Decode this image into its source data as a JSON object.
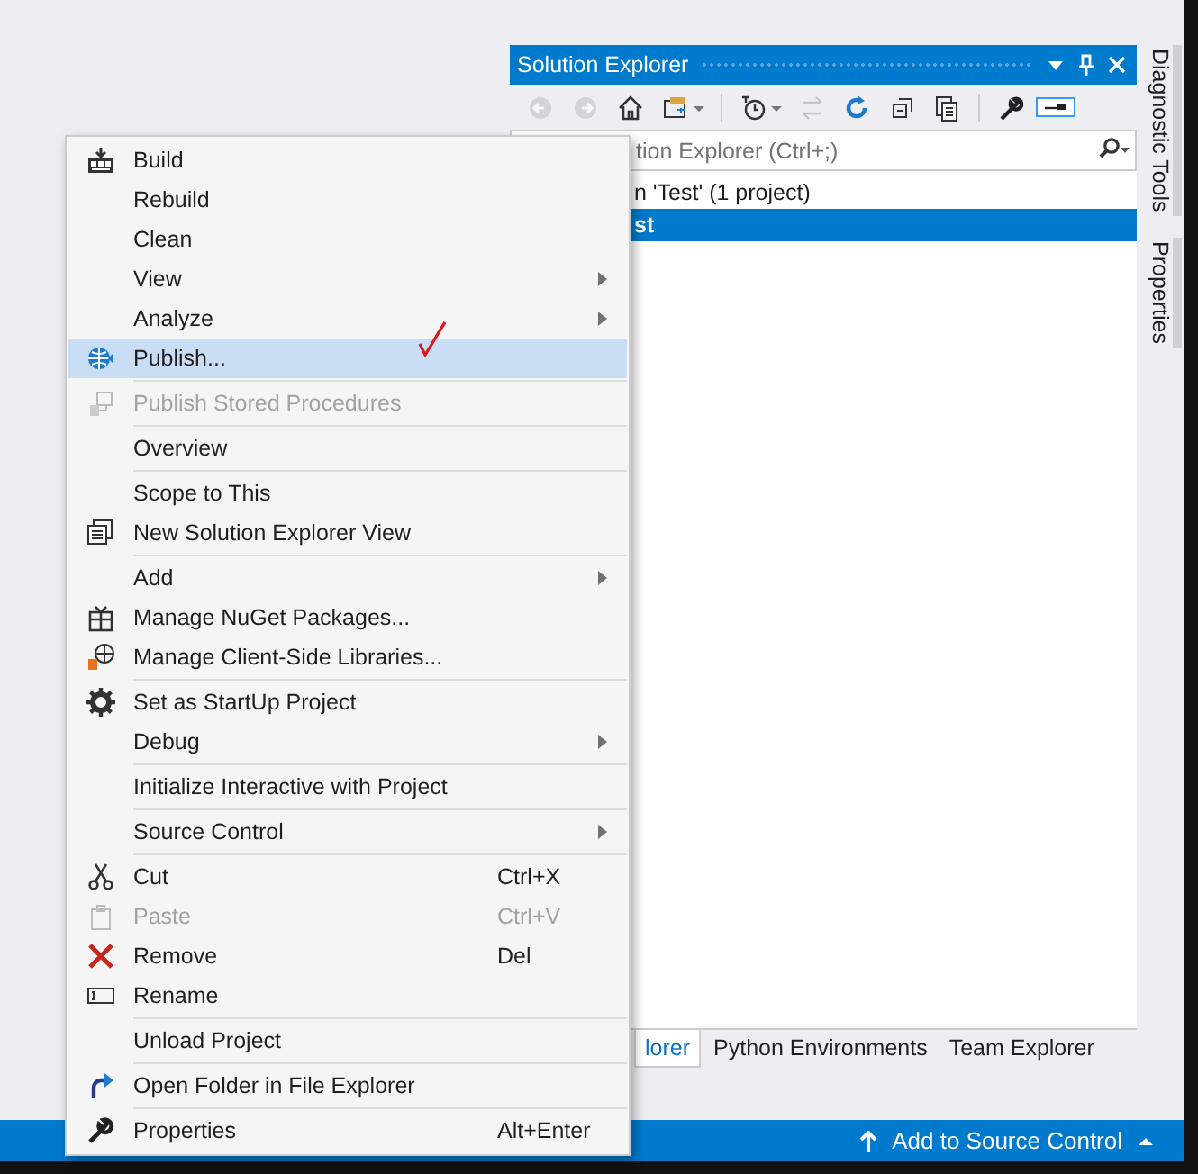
{
  "panel": {
    "title": "Solution Explorer",
    "toolbar": [
      {
        "disabled": true,
        "selected": false
      },
      {
        "disabled": true,
        "selected": false
      },
      {
        "disabled": false,
        "selected": false
      },
      {
        "disabled": false,
        "selected": false
      },
      {
        "disabled": false,
        "selected": false
      },
      {
        "disabled": true,
        "selected": false
      },
      {
        "disabled": false,
        "selected": false
      },
      {
        "disabled": false,
        "selected": false
      },
      {
        "disabled": false,
        "selected": false
      },
      {
        "disabled": false,
        "selected": false
      },
      {
        "disabled": false,
        "selected": true
      }
    ],
    "search": {
      "placeholder": "tion Explorer (Ctrl+;)"
    },
    "tree_rows": [
      {
        "label": "n 'Test' (1 project)",
        "selected": false
      },
      {
        "label": "st",
        "selected": true
      }
    ],
    "tabs": [
      {
        "label": "lorer",
        "selected": true
      },
      {
        "label": "Python Environments",
        "selected": false
      },
      {
        "label": "Team Explorer",
        "selected": false
      }
    ]
  },
  "side_tabs": [
    {
      "label": "Diagnostic Tools"
    },
    {
      "label": "Properties"
    }
  ],
  "menu": {
    "groups": [
      {
        "items": [
          {
            "label": "Build",
            "submenu": false,
            "disabled": false,
            "selected": false
          },
          {
            "label": "Rebuild",
            "submenu": false,
            "disabled": false,
            "selected": false
          },
          {
            "label": "Clean",
            "submenu": false,
            "disabled": false,
            "selected": false
          },
          {
            "label": "View",
            "submenu": true,
            "disabled": false,
            "selected": false
          },
          {
            "label": "Analyze",
            "submenu": true,
            "disabled": false,
            "selected": false
          },
          {
            "label": "Publish...",
            "submenu": false,
            "disabled": false,
            "selected": true
          }
        ]
      },
      {
        "items": [
          {
            "label": "Publish Stored Procedures",
            "submenu": false,
            "disabled": true,
            "selected": false
          }
        ]
      },
      {
        "items": [
          {
            "label": "Overview",
            "submenu": false,
            "disabled": false,
            "selected": false
          }
        ]
      },
      {
        "items": [
          {
            "label": "Scope to This",
            "submenu": false,
            "disabled": false,
            "selected": false
          },
          {
            "label": "New Solution Explorer View",
            "submenu": false,
            "disabled": false,
            "selected": false
          }
        ]
      },
      {
        "items": [
          {
            "label": "Add",
            "submenu": true,
            "disabled": false,
            "selected": false
          },
          {
            "label": "Manage NuGet Packages...",
            "submenu": false,
            "disabled": false,
            "selected": false
          },
          {
            "label": "Manage Client-Side Libraries...",
            "submenu": false,
            "disabled": false,
            "selected": false
          }
        ]
      },
      {
        "items": [
          {
            "label": "Set as StartUp Project",
            "submenu": false,
            "disabled": false,
            "selected": false
          },
          {
            "label": "Debug",
            "submenu": true,
            "disabled": false,
            "selected": false
          }
        ]
      },
      {
        "items": [
          {
            "label": "Initialize Interactive with Project",
            "submenu": false,
            "disabled": false,
            "selected": false
          }
        ]
      },
      {
        "items": [
          {
            "label": "Source Control",
            "submenu": true,
            "disabled": false,
            "selected": false
          }
        ]
      },
      {
        "items": [
          {
            "label": "Cut",
            "shortcut": "Ctrl+X",
            "submenu": false,
            "disabled": false,
            "selected": false
          },
          {
            "label": "Paste",
            "shortcut": "Ctrl+V",
            "submenu": false,
            "disabled": true,
            "selected": false
          },
          {
            "label": "Remove",
            "shortcut": "Del",
            "submenu": false,
            "disabled": false,
            "selected": false
          },
          {
            "label": "Rename",
            "submenu": false,
            "disabled": false,
            "selected": false
          }
        ]
      },
      {
        "items": [
          {
            "label": "Unload Project",
            "submenu": false,
            "disabled": false,
            "selected": false
          }
        ]
      },
      {
        "items": [
          {
            "label": "Open Folder in File Explorer",
            "submenu": false,
            "disabled": false,
            "selected": false
          }
        ]
      },
      {
        "items": [
          {
            "label": "Properties",
            "shortcut": "Alt+Enter",
            "submenu": false,
            "disabled": false,
            "selected": false
          }
        ]
      }
    ]
  },
  "status_bar": {
    "text": "Add to Source Control"
  }
}
